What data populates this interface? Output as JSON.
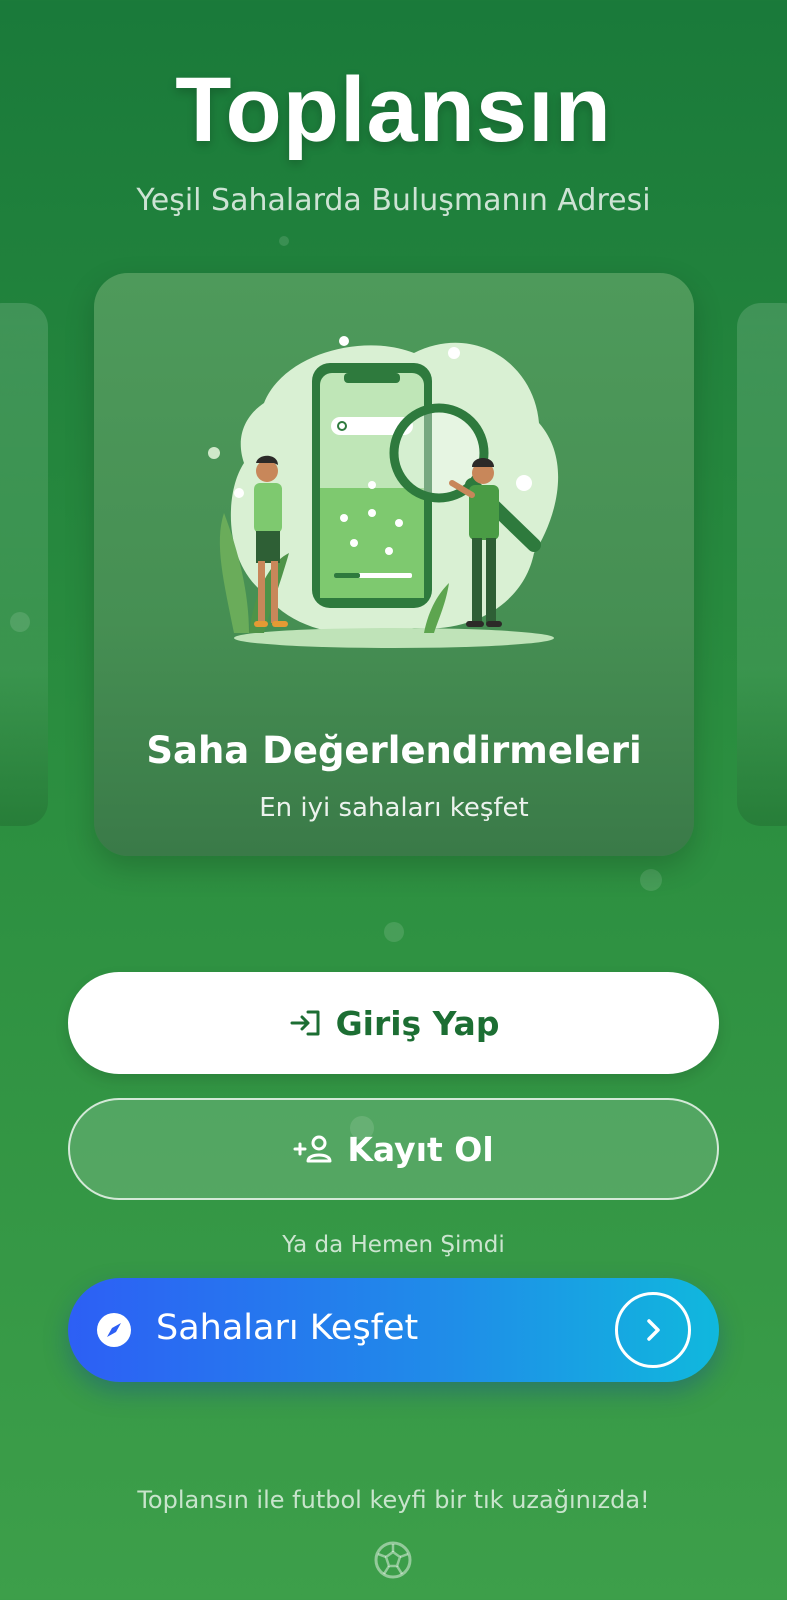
{
  "header": {
    "title": "Toplansın",
    "subtitle": "Yeşil Sahalarda Buluşmanın Adresi"
  },
  "carousel": {
    "current": {
      "title": "Saha Değerlendirmeleri",
      "subtitle": "En iyi sahaları keşfet",
      "illustration_icon": "magnifier-phone-field-illustration"
    }
  },
  "actions": {
    "login_label": "Giriş Yap",
    "register_label": "Kayıt Ol",
    "or_text": "Ya da Hemen Şimdi",
    "explore_label": "Sahaları Keşfet"
  },
  "footer": {
    "tagline": "Toplansın ile futbol keyfi bir tık uzağınızda!",
    "icon": "soccer-ball-icon"
  },
  "colors": {
    "background_top": "#1a7a3a",
    "background_bottom": "#3d9f4a",
    "login_text": "#1c6e33",
    "explore_gradient_start": "#2d5ff5",
    "explore_gradient_end": "#10b8dd"
  }
}
